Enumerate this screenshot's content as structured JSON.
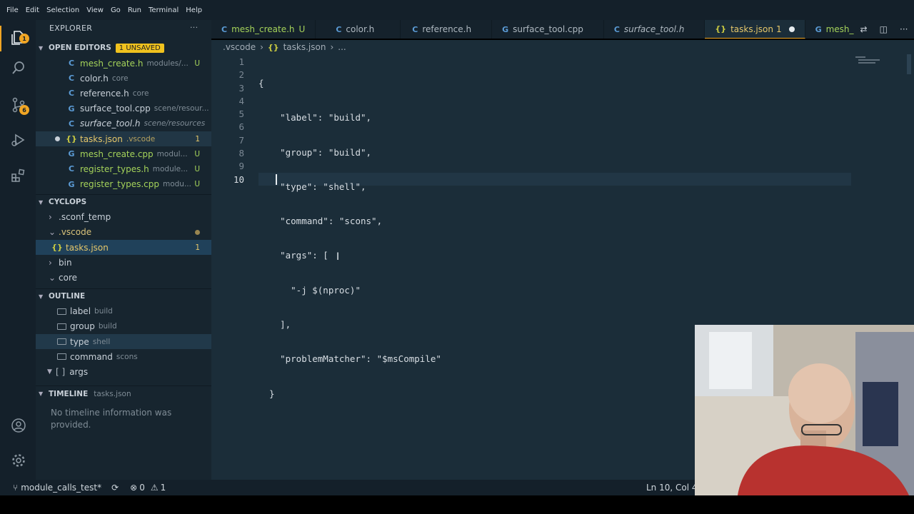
{
  "menu": [
    "File",
    "Edit",
    "Selection",
    "View",
    "Go",
    "Run",
    "Terminal",
    "Help"
  ],
  "activity": {
    "explorer_badge": "1",
    "scm_badge": "6"
  },
  "sidebar": {
    "title": "EXPLORER",
    "more": "···",
    "open_editors": {
      "label": "OPEN EDITORS",
      "unsaved": "1 UNSAVED",
      "items": [
        {
          "icon": "C",
          "name": "mesh_create.h",
          "desc": "modules/...",
          "status": "U"
        },
        {
          "icon": "C",
          "name": "color.h",
          "desc": "core",
          "status": ""
        },
        {
          "icon": "C",
          "name": "reference.h",
          "desc": "core",
          "status": ""
        },
        {
          "icon": "G",
          "name": "surface_tool.cpp",
          "desc": "scene/resour...",
          "status": ""
        },
        {
          "icon": "C",
          "name": "surface_tool.h",
          "desc": "scene/resources",
          "status": ""
        },
        {
          "icon": "{}",
          "name": "tasks.json",
          "desc": ".vscode",
          "status": "1"
        },
        {
          "icon": "G",
          "name": "mesh_create.cpp",
          "desc": "modul...",
          "status": "U"
        },
        {
          "icon": "C",
          "name": "register_types.h",
          "desc": "module...",
          "status": "U"
        },
        {
          "icon": "G",
          "name": "register_types.cpp",
          "desc": "modu...",
          "status": "U"
        }
      ]
    },
    "project": {
      "label": "CYCLOPS",
      "items": [
        {
          "chev": "›",
          "name": ".sconf_temp"
        },
        {
          "chev": "⌄",
          "name": ".vscode"
        },
        {
          "icon": "{}",
          "name": "tasks.json",
          "status": "1"
        },
        {
          "chev": "›",
          "name": "bin"
        },
        {
          "chev": "⌄",
          "name": "core"
        }
      ]
    },
    "outline": {
      "label": "OUTLINE",
      "items": [
        {
          "name": "label",
          "desc": "build"
        },
        {
          "name": "group",
          "desc": "build"
        },
        {
          "name": "type",
          "desc": "shell"
        },
        {
          "name": "command",
          "desc": "scons"
        },
        {
          "name": "args",
          "desc": ""
        }
      ]
    },
    "timeline": {
      "label": "TIMELINE",
      "file": "tasks.json",
      "message": "No timeline information was provided."
    }
  },
  "tabs": [
    {
      "icon": "C",
      "label": "mesh_create.h",
      "suffix": "U"
    },
    {
      "icon": "C",
      "label": "color.h",
      "suffix": ""
    },
    {
      "icon": "C",
      "label": "reference.h",
      "suffix": ""
    },
    {
      "icon": "G",
      "label": "surface_tool.cpp",
      "suffix": ""
    },
    {
      "icon": "C",
      "label": "surface_tool.h",
      "suffix": ""
    },
    {
      "icon": "{}",
      "label": "tasks.json",
      "suffix": "1"
    },
    {
      "icon": "G",
      "label": "mesh_cre",
      "suffix": ""
    }
  ],
  "breadcrumb": {
    "folder": ".vscode",
    "sep": "›",
    "icon": "{}",
    "file": "tasks.json",
    "more": "..."
  },
  "editor": {
    "line_numbers": [
      "1",
      "2",
      "3",
      "4",
      "5",
      "6",
      "7",
      "8",
      "9",
      "10"
    ],
    "lines": [
      "{",
      "    \"label\": \"build\",",
      "    \"group\": \"build\",",
      "    \"type\": \"shell\",",
      "    \"command\": \"scons\",",
      "    \"args\": [",
      "      \"-j $(nproc)\"",
      "    ],",
      "    \"problemMatcher\": \"$msCompile\"",
      "  }"
    ]
  },
  "status": {
    "branch": "module_calls_test*",
    "errors": "0",
    "warnings": "1",
    "cursor": "Ln 10, Col 4"
  },
  "colors": {
    "accent": "#f0a524",
    "untracked": "#a5d35a",
    "json_icon": "#cbcb41",
    "c_icon": "#5b9bd5"
  }
}
